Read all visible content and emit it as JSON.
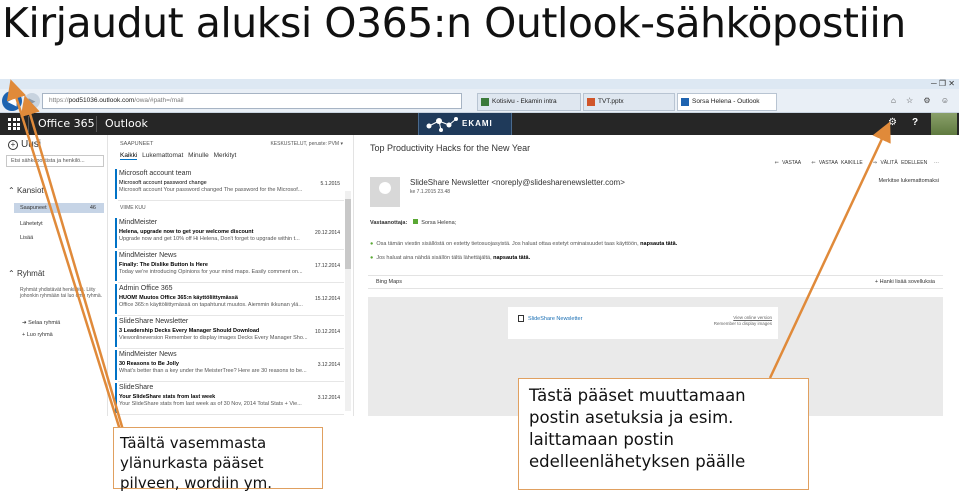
{
  "slide": {
    "title": "Kirjaudut aluksi O365:n Outlook-sähköpostiin"
  },
  "browser": {
    "url_prefix": "https://",
    "url_host": "pod51036.outlook.com",
    "url_path": "/owa/#path=/mail",
    "window_controls": "─ ❐ ✕",
    "tabs": [
      {
        "label": "Kotisivu - Ekamin intra",
        "color": "#3b7a3a"
      },
      {
        "label": "TVT.pptx",
        "color": "#d0552a"
      },
      {
        "label": "Sorsa Helena - Outlook We...",
        "color": "#1e63b0"
      }
    ],
    "toolbar_icons": "⌂ ☆ ⚙ ☺"
  },
  "o365_header": {
    "app_name": "Office 365",
    "module": "Outlook",
    "logo_text": "EKAMI",
    "settings_glyph": "⚙",
    "help_glyph": "?"
  },
  "folders": {
    "new_label": "Uusi",
    "search_placeholder": "Etsi sähköpostista ja henkilö...",
    "section_folders": "Kansiot",
    "items": [
      {
        "label": "Saapuneet",
        "count": "46"
      },
      {
        "label": "Lähetetyt"
      },
      {
        "label": "Lisää"
      }
    ],
    "section_groups": "Ryhmät",
    "groups_note": "Ryhmät yhdistävät henkilöitä. Liity johonkin ryhmään tai luo oma ryhmä.",
    "actions": [
      "Selaa ryhmiä",
      "Luo ryhmä"
    ]
  },
  "message_list": {
    "header": "SAAPUNEET",
    "sort_label": "KESKUSTELUT, peruste: PVM",
    "filters": [
      "Kaikki",
      "Lukemattomat",
      "Minulle",
      "Merkityt"
    ],
    "divider_label": "VIIME KUU",
    "messages": [
      {
        "from": "Microsoft account team",
        "subject": "Microsoft account password change",
        "preview": "Microsoft account Your password changed The password for the Microsof...",
        "date": "5.1.2015"
      },
      {
        "from": "MindMeister",
        "subject": "Helena, upgrade now to get your welcome discount",
        "preview": "Upgrade now and get 10% off Hi Helena, Don't forget to upgrade within t...",
        "date": "20.12.2014"
      },
      {
        "from": "MindMeister News",
        "subject": "Finally: The Dislike Button Is Here",
        "preview": "Today we're introducing Opinions for your mind maps. Easily comment on...",
        "date": "17.12.2014"
      },
      {
        "from": "Admin Office 365",
        "subject": "HUOM! Muutos Office 365:n käyttöliittymässä",
        "preview": "Office 365:n käyttöliittymässä on tapahtunut muutos. Aiemmin ikkunan ylä...",
        "date": "15.12.2014"
      },
      {
        "from": "SlideShare Newsletter",
        "subject": "3 Leadership Decks Every Manager Should Download",
        "preview": "Viewonlineversion Remember to display images Decks Every Manager Sho...",
        "date": "10.12.2014"
      },
      {
        "from": "MindMeister News",
        "subject": "30 Reasons to Be Jolly",
        "preview": "What's better than a key under the MeisterTree? Here are 30 reasons to be...",
        "date": "3.12.2014"
      },
      {
        "from": "SlideShare",
        "subject": "Your SlideShare stats from last week",
        "preview": "Your SlideShare stats from last week as of 30 Nov, 2014 Total Stats + Vie...",
        "date": "3.12.2014"
      }
    ]
  },
  "reading_pane": {
    "title": "Top Productivity Hacks for the New Year",
    "actions": [
      "VASTAA",
      "VASTAA KAIKILLE",
      "VÄLITÄ EDELLEEN"
    ],
    "mark_unread": "Merkitse lukemattomaksi",
    "sender": "SlideShare Newsletter <noreply@slidesharenewsletter.com>",
    "date": "ke 7.1.2015 23.48",
    "to_label": "Vastaanottaja:",
    "to_name": "Sorsa Helena;",
    "info_line1_text": "Osa tämän viestin sisällöstä on estetty tietosuojasyistä. Jos haluat ottaa estetyt ominaisuudet taas käyttöön,",
    "info_line1_link": "napsauta tätä.",
    "info_line2_text": "Jos haluat aina nähdä sisällön tältä lähettäjältä,",
    "info_line2_link": "napsauta tätä.",
    "bing_label": "Bing Maps",
    "addins_label": "+ Hanki lisää sovelluksia",
    "card_logo": "SlideShare Newsletter",
    "card_view_online": "View online version",
    "card_remember": "Remember to display images"
  },
  "callouts": {
    "left": "Täältä vasemmasta ylänurkasta pääset pilveen, wordiin ym.",
    "right": "Tästä pääset muuttamaan postin asetuksia ja esim. laittamaan postin edelleenlähetyksen päälle"
  },
  "colors": {
    "accent_blue": "#0072c6",
    "callout_arrow": "#e08a3a",
    "header_dark": "#262626"
  }
}
